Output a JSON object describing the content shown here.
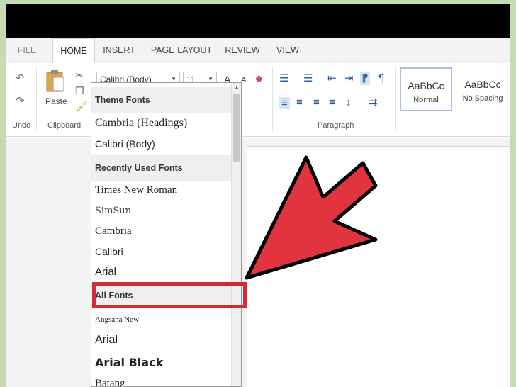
{
  "tabs": {
    "file": "FILE",
    "home": "HOME",
    "insert": "INSERT",
    "page_layout": "PAGE LAYOUT",
    "review": "REVIEW",
    "view": "VIEW"
  },
  "ribbon": {
    "undo_label": "Undo",
    "paste_label": "Paste",
    "clipboard_label": "Clipboard",
    "font_name": "Calibri (Body)",
    "font_size": "11",
    "grow_font": "A",
    "shrink_font": "A",
    "paragraph_label": "Paragraph",
    "styles": [
      {
        "sample": "AaBbCc",
        "name": "Normal"
      },
      {
        "sample": "AaBbCc",
        "name": "No Spacing"
      }
    ]
  },
  "font_dropdown": {
    "theme_header": "Theme Fonts",
    "theme_fonts": [
      "Cambria (Headings)",
      "Calibri (Body)"
    ],
    "recent_header": "Recently Used Fonts",
    "recent_fonts": [
      "Times New Roman",
      "SimSun",
      "Cambria",
      "Calibri",
      "Arial"
    ],
    "all_header": "All Fonts",
    "all_fonts": [
      "Angsana New",
      "Arial",
      "Arial Black",
      "Batang"
    ]
  },
  "colors": {
    "background": "#c3dcb3",
    "title_bar": "#000000",
    "annotation_red": "#d12a3a",
    "arrow_fill": "#e0343f"
  }
}
